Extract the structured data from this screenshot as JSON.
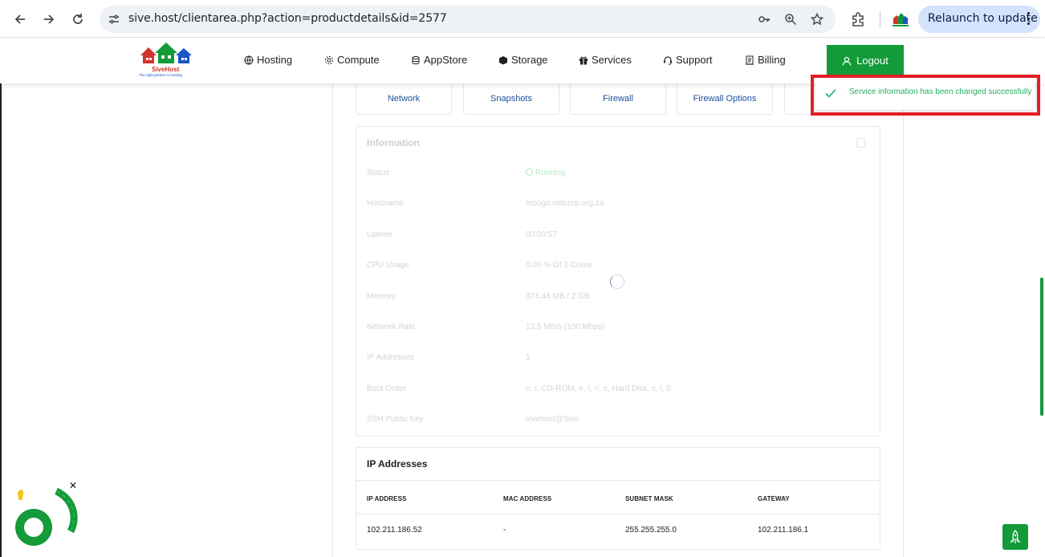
{
  "browser": {
    "url": "sive.host/clientarea.php?action=productdetails&id=2577",
    "relaunch_label": "Relaunch to update"
  },
  "header": {
    "logo_brand": "SiveHost",
    "logo_tagline": "The right partner in hosting.",
    "menu": [
      {
        "label": "Hosting",
        "icon": "globe-icon"
      },
      {
        "label": "Compute",
        "icon": "gear-icon"
      },
      {
        "label": "AppStore",
        "icon": "database-icon"
      },
      {
        "label": "Storage",
        "icon": "cube-icon"
      },
      {
        "label": "Services",
        "icon": "gift-icon"
      },
      {
        "label": "Support",
        "icon": "headset-icon"
      },
      {
        "label": "Billing",
        "icon": "receipt-icon"
      }
    ],
    "logout_label": "Logout"
  },
  "tabs": [
    "Network",
    "Snapshots",
    "Firewall",
    "Firewall Options"
  ],
  "information": {
    "title": "Information",
    "rows": [
      {
        "label": "Status",
        "value": "Running"
      },
      {
        "label": "Hostname",
        "value": "tebogo.nefcorp.org.za"
      },
      {
        "label": "Uptime",
        "value": "00:00:57"
      },
      {
        "label": "CPU Usage",
        "value": "0.00 % Of 2 Cores"
      },
      {
        "label": "Memory",
        "value": "374.44 MB / 2 GB"
      },
      {
        "label": "Network Rate",
        "value": "12.5 MB/s (100 Mbps)"
      },
      {
        "label": "IP Addresses",
        "value": "1"
      },
      {
        "label": "Boot Order",
        "value": "o, r, CD-ROM, e, r, =, s, Hard Disk, s, i, 0"
      },
      {
        "label": "SSH Public Key",
        "value": "sivehost@Sive"
      }
    ]
  },
  "ip_addresses": {
    "title": "IP Addresses",
    "columns": [
      "IP ADDRESS",
      "MAC ADDRESS",
      "SUBNET MASK",
      "GATEWAY"
    ],
    "rows": [
      [
        "102.211.186.52",
        "-",
        "255.255.255.0",
        "102.211.186.1"
      ]
    ]
  },
  "toast": {
    "message": "Service information has been changed successfully"
  },
  "colors": {
    "brand_green": "#139a39",
    "highlight_red": "#e41e26",
    "link_blue": "#1b4f9c",
    "success_green": "#27ae60"
  }
}
